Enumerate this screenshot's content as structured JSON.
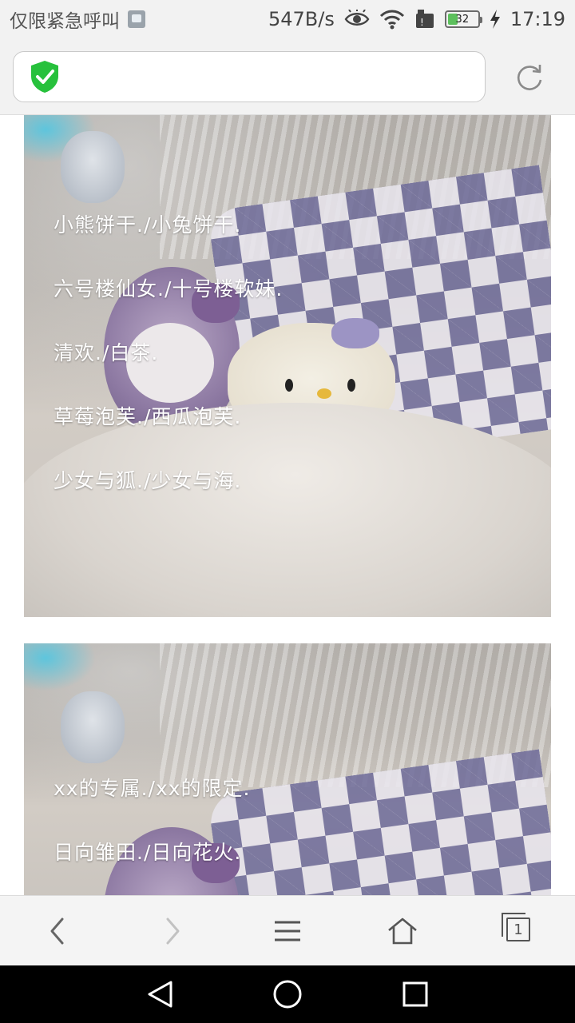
{
  "status_bar": {
    "carrier": "仅限紧急呼叫",
    "net_speed": "547B/s",
    "battery_level": "32",
    "time": "17:19",
    "icons": [
      "sim-card-icon",
      "eye-icon",
      "wifi-icon",
      "data-signal-icon",
      "battery-icon",
      "charging-icon"
    ]
  },
  "address_bar": {
    "url": "",
    "security_icon": "shield-check-icon",
    "refresh_icon": "refresh-icon",
    "accent_color": "#27c13c"
  },
  "content": {
    "images": [
      {
        "lines": [
          "小熊饼干./小兔饼干.",
          "六号楼仙女./十号楼软妹.",
          "清欢./白茶.",
          "草莓泡芙./西瓜泡芙.",
          "少女与狐./少女与海."
        ]
      },
      {
        "lines": [
          "xx的专属./xx的限定.",
          "日向雏田./日向花火."
        ]
      }
    ]
  },
  "browser_nav": {
    "icons": [
      "back-icon",
      "forward-icon",
      "menu-icon",
      "home-icon",
      "tabs-icon"
    ],
    "tab_count": "1"
  },
  "system_nav": {
    "icons": [
      "system-back-icon",
      "system-home-icon",
      "system-recents-icon"
    ]
  }
}
